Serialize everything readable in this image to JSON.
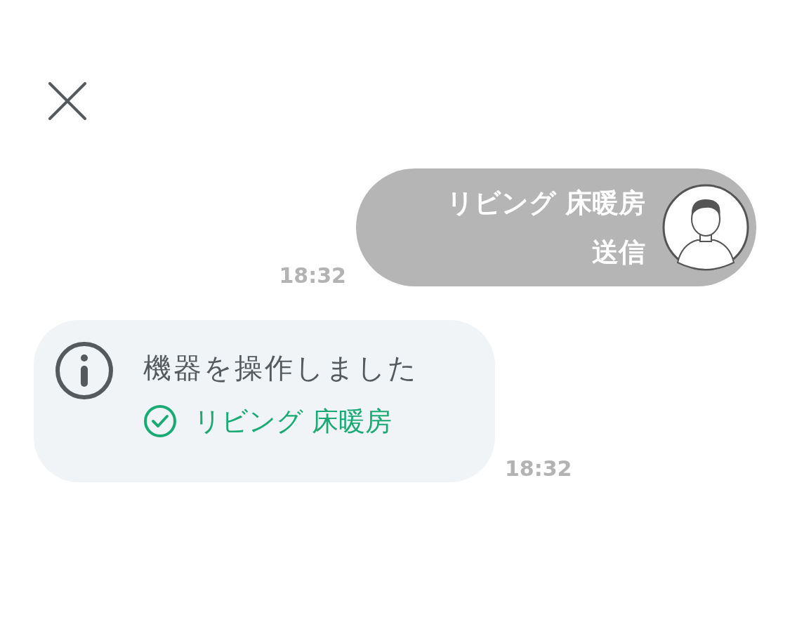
{
  "close_button": {
    "kind": "close"
  },
  "messages": [
    {
      "kind": "sent",
      "lines": [
        "リビング 床暖房",
        "送信"
      ],
      "time": "18:32"
    },
    {
      "kind": "system",
      "text": "機器を操作しました",
      "device": {
        "label": "リビング 床暖房",
        "done": true
      },
      "time": "18:32"
    }
  ]
}
